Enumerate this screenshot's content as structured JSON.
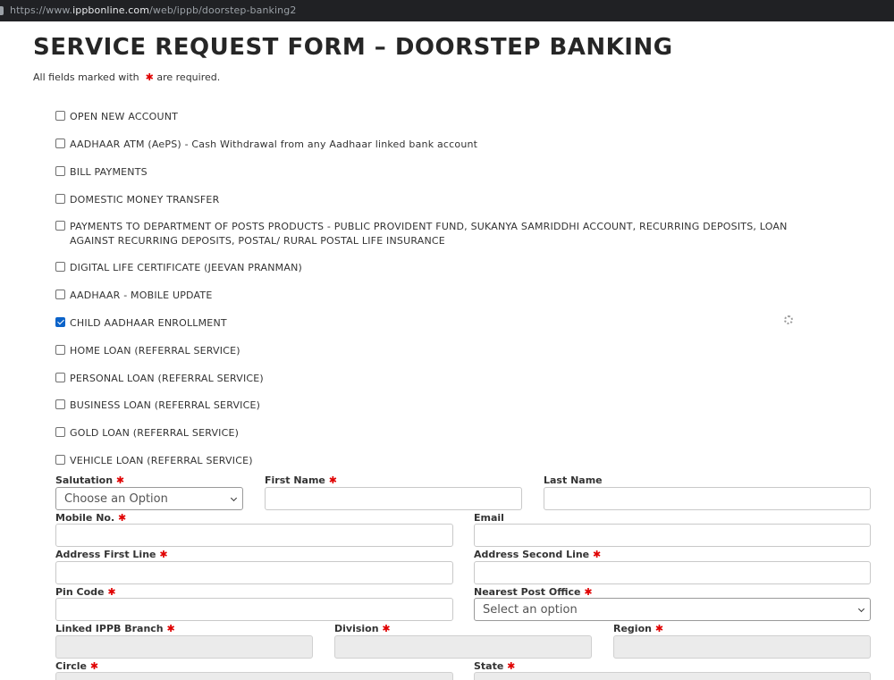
{
  "browser": {
    "url_prefix": "https://www.",
    "url_host": "ippbonline.com",
    "url_path": "/web/ippb/doorstep-banking2"
  },
  "page": {
    "title": "SERVICE REQUEST FORM – DOORSTEP BANKING",
    "required_note_prefix": "All fields marked with",
    "required_note_suffix": "are required.",
    "required_marker": "✱"
  },
  "services": [
    {
      "label": "OPEN NEW ACCOUNT",
      "checked": false
    },
    {
      "label": "AADHAAR ATM (AePS) - Cash Withdrawal from any Aadhaar linked bank account",
      "checked": false
    },
    {
      "label": "BILL PAYMENTS",
      "checked": false
    },
    {
      "label": "DOMESTIC MONEY TRANSFER",
      "checked": false
    },
    {
      "label": "PAYMENTS TO DEPARTMENT OF POSTS PRODUCTS - PUBLIC PROVIDENT FUND, SUKANYA SAMRIDDHI ACCOUNT, RECURRING DEPOSITS, LOAN AGAINST RECURRING DEPOSITS, POSTAL/ RURAL POSTAL LIFE INSURANCE",
      "checked": false
    },
    {
      "label": "DIGITAL LIFE CERTIFICATE (JEEVAN PRANMAN)",
      "checked": false
    },
    {
      "label": "AADHAAR - MOBILE UPDATE",
      "checked": false
    },
    {
      "label": "CHILD AADHAAR ENROLLMENT",
      "checked": true
    },
    {
      "label": "HOME LOAN (REFERRAL SERVICE)",
      "checked": false
    },
    {
      "label": "PERSONAL LOAN (REFERRAL SERVICE)",
      "checked": false
    },
    {
      "label": "BUSINESS LOAN (REFERRAL SERVICE)",
      "checked": false
    },
    {
      "label": "GOLD LOAN (REFERRAL SERVICE)",
      "checked": false
    },
    {
      "label": "VEHICLE LOAN (REFERRAL SERVICE)",
      "checked": false
    }
  ],
  "form": {
    "salutation": {
      "label": "Salutation",
      "value": "Choose an Option"
    },
    "first_name": {
      "label": "First Name",
      "value": ""
    },
    "last_name": {
      "label": "Last Name",
      "value": ""
    },
    "mobile": {
      "label": "Mobile No.",
      "value": ""
    },
    "email": {
      "label": "Email",
      "value": ""
    },
    "address1": {
      "label": "Address First Line",
      "value": ""
    },
    "address2": {
      "label": "Address Second Line",
      "value": ""
    },
    "pin": {
      "label": "Pin Code",
      "value": ""
    },
    "post_office": {
      "label": "Nearest Post Office",
      "value": "Select an option"
    },
    "branch": {
      "label": "Linked IPPB Branch",
      "value": ""
    },
    "division": {
      "label": "Division",
      "value": ""
    },
    "region": {
      "label": "Region",
      "value": ""
    },
    "circle": {
      "label": "Circle",
      "value": ""
    },
    "state": {
      "label": "State",
      "value": ""
    }
  },
  "colors": {
    "required": "#e00000",
    "checkbox_checked": "#0b63c9",
    "disabled_field": "#ebebeb"
  },
  "icons": {
    "loading": "spinner-icon"
  }
}
